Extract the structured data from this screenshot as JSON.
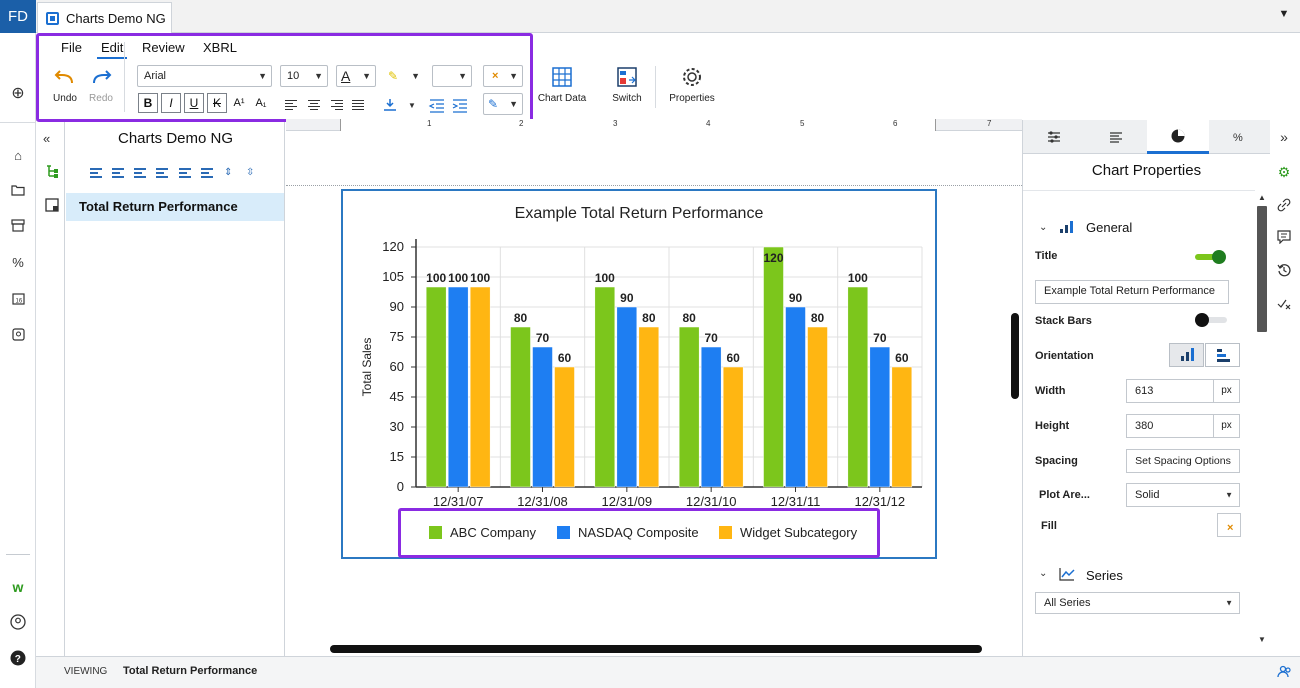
{
  "app": {
    "logo": "FD",
    "doc_tab": "Charts Demo NG"
  },
  "menu": [
    "File",
    "Edit",
    "Review",
    "XBRL"
  ],
  "toolbar": {
    "undo": "Undo",
    "redo": "Redo",
    "font_name": "Arial",
    "font_size": "10",
    "chart_data": "Chart Data",
    "switch": "Switch",
    "properties": "Properties"
  },
  "outline": {
    "title": "Charts Demo NG",
    "selected_item": "Total Return Performance"
  },
  "ruler": [
    "1",
    "2",
    "3",
    "4",
    "5",
    "6",
    "7"
  ],
  "properties_panel": {
    "title": "Chart Properties",
    "general_section": "General",
    "title_label": "Title",
    "title_toggle": "on",
    "title_value": "Example Total Return Performance",
    "stack_bars_label": "Stack Bars",
    "stack_bars_toggle": "off",
    "orientation_label": "Orientation",
    "width_label": "Width",
    "width_value": "613",
    "width_unit": "px",
    "height_label": "Height",
    "height_value": "380",
    "height_unit": "px",
    "spacing_label": "Spacing",
    "spacing_button": "Set Spacing Options",
    "plot_area_label": "Plot Are...",
    "plot_area_value": "Solid",
    "fill_label": "Fill",
    "series_section": "Series",
    "series_value": "All Series"
  },
  "status": {
    "mode": "VIEWING",
    "document": "Total Return Performance"
  },
  "colors": {
    "accent": "#1b6fd1",
    "highlight": "#8a2be2",
    "series1": "#7cc61c",
    "series2": "#1e7ef2",
    "series3": "#ffb612"
  },
  "chart_data": {
    "type": "bar",
    "title": "Example Total Return Performance",
    "ylabel": "Total Sales",
    "xlabel": "",
    "ylim": [
      0,
      120
    ],
    "yticks": [
      0,
      15,
      30,
      45,
      60,
      75,
      90,
      105,
      120
    ],
    "categories": [
      "12/31/07",
      "12/31/08",
      "12/31/09",
      "12/31/10",
      "12/31/11",
      "12/31/12"
    ],
    "series": [
      {
        "name": "ABC Company",
        "color": "#7cc61c",
        "values": [
          100,
          80,
          100,
          80,
          120,
          100
        ]
      },
      {
        "name": "NASDAQ Composite",
        "color": "#1e7ef2",
        "values": [
          100,
          70,
          90,
          70,
          90,
          70
        ]
      },
      {
        "name": "Widget Subcategory",
        "color": "#ffb612",
        "values": [
          100,
          60,
          80,
          60,
          80,
          60
        ]
      }
    ],
    "grid": true,
    "legend": "bottom"
  }
}
